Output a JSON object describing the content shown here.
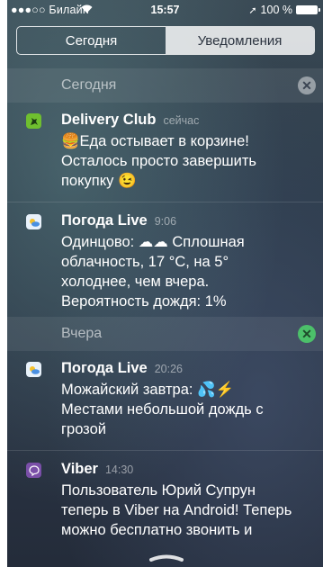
{
  "status_bar": {
    "carrier": "●●●○○ Билайн",
    "time": "15:57",
    "battery": "100 %"
  },
  "tabs": [
    {
      "label": "Сегодня",
      "selected": false
    },
    {
      "label": "Уведомления",
      "selected": true
    }
  ],
  "sections": [
    {
      "title": "Сегодня",
      "notifications": [
        {
          "app": "Delivery Club",
          "time": "сейчас",
          "icon": "delivery-club-icon",
          "icon_color": "#6fbf2f",
          "lines": [
            "🍔Еда остывает в корзине!",
            "Осталось просто завершить",
            "покупку 😉"
          ]
        },
        {
          "app": "Погода Live",
          "time": "9:06",
          "icon": "weather-icon",
          "icon_color": "#4a90e2",
          "lines": [
            "Одинцово: ☁☁ Сплошная",
            "облачность, 17 °C, на 5°",
            "холоднее, чем вчера.",
            "Вероятность дождя: 1%"
          ]
        }
      ]
    },
    {
      "title": "Вчера",
      "notifications": [
        {
          "app": "Погода Live",
          "time": "20:26",
          "icon": "weather-icon",
          "icon_color": "#4a90e2",
          "lines": [
            "Можайский завтра: 💦⚡",
            "Местами небольшой дождь с",
            "грозой"
          ]
        },
        {
          "app": "Viber",
          "time": "14:30",
          "icon": "viber-icon",
          "icon_color": "#7a4fa8",
          "lines": [
            "Пользователь Юрий Супрун",
            "теперь в Viber на Android! Теперь",
            "можно бесплатно звонить и"
          ]
        }
      ]
    }
  ],
  "colors": {
    "section_clear_today": "#9aa3ad",
    "section_clear_yesterday": "#4cc06a"
  }
}
